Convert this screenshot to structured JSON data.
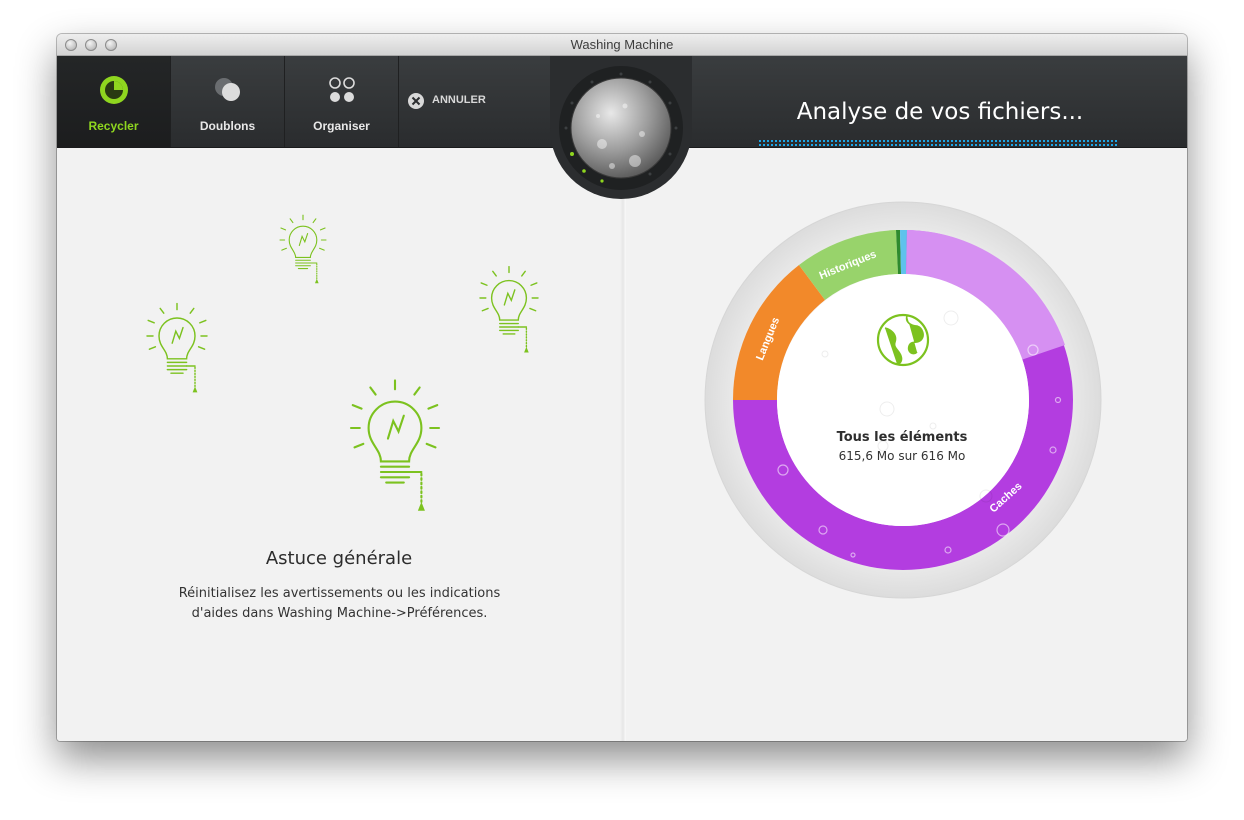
{
  "window": {
    "title": "Washing Machine"
  },
  "toolbar": {
    "tabs": [
      {
        "label": "Recycler",
        "icon": "recycle-icon",
        "active": true
      },
      {
        "label": "Doublons",
        "icon": "duplicates-icon",
        "active": false
      },
      {
        "label": "Organiser",
        "icon": "organize-icon",
        "active": false
      }
    ],
    "cancel_label": "ANNULER",
    "status_title": "Analyse de vos fichiers..."
  },
  "tip": {
    "title": "Astuce générale",
    "text_line1": "Réinitialisez les avertissements ou les indications",
    "text_line2": "d'aides dans Washing Machine->Préférences."
  },
  "summary": {
    "title": "Tous les éléments",
    "subtitle": "615,6 Mo sur 616 Mo",
    "icon": "globe-icon"
  },
  "segments": [
    {
      "label": "Caches",
      "color": "#b33de0"
    },
    {
      "label": "Langues",
      "color": "#f2892a"
    },
    {
      "label": "Historiques",
      "color": "#98d36b"
    }
  ],
  "colors": {
    "accent": "#8fd61f",
    "progress": "#1ea7e8",
    "bulb": "#7cc21f"
  }
}
